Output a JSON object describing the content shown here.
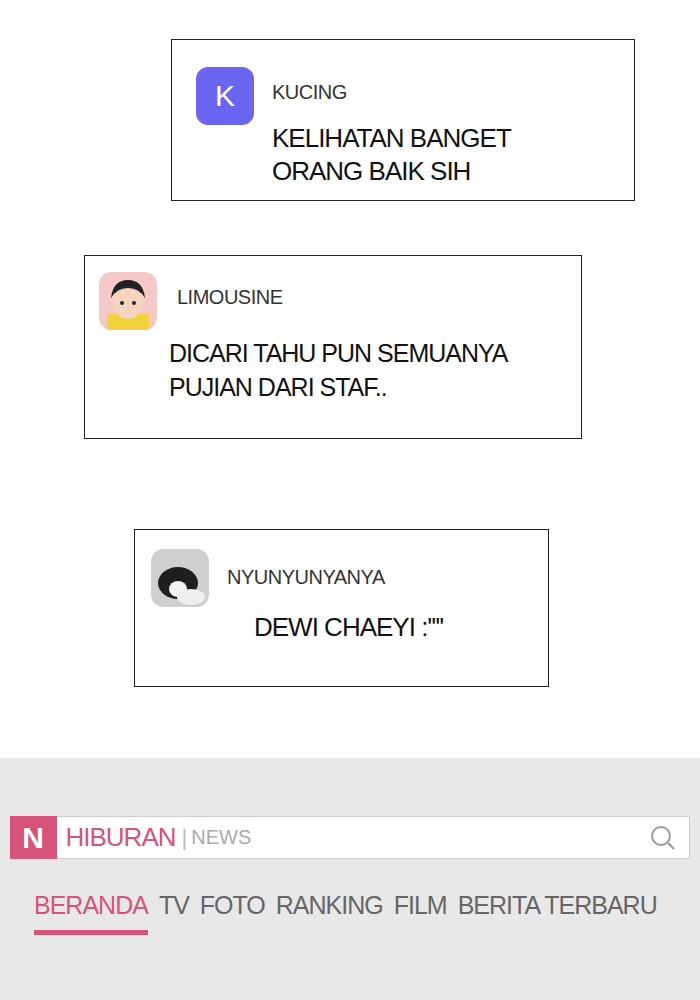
{
  "comments": [
    {
      "name": "KUCING",
      "avatar": {
        "kind": "letter",
        "letter": "K"
      },
      "lines": [
        "KELIHATAN BANGET",
        "ORANG BAIK SIH"
      ]
    },
    {
      "name": "LIMOUSINE",
      "avatar": {
        "kind": "cartoon"
      },
      "lines": [
        "DICARI TAHU PUN SEMUANYA",
        "PUJIAN DARI STAF.."
      ]
    },
    {
      "name": "NYUNYUNYANYA",
      "avatar": {
        "kind": "photo"
      },
      "lines": [
        "DEWI CHAEYI :''''"
      ]
    }
  ],
  "app_bar": {
    "logo": "N",
    "section": "HIBURAN",
    "separator": "|",
    "sub": "NEWS"
  },
  "nav": [
    {
      "label": "BERANDA",
      "selected": true
    },
    {
      "label": "TV",
      "selected": false
    },
    {
      "label": "FOTO",
      "selected": false
    },
    {
      "label": "RANKING",
      "selected": false
    },
    {
      "label": "FILM",
      "selected": false
    },
    {
      "label": "BERITA TERBARU",
      "selected": false
    }
  ]
}
